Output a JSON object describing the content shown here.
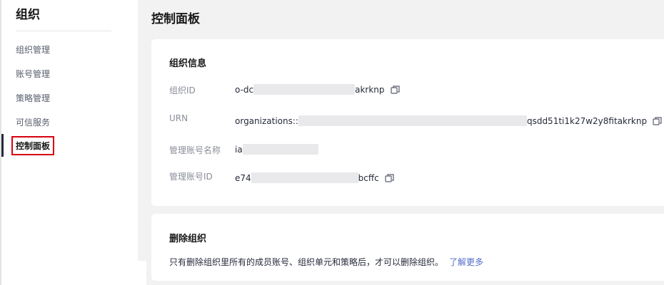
{
  "sidebar": {
    "title": "组织",
    "items": [
      {
        "label": "组织管理"
      },
      {
        "label": "账号管理"
      },
      {
        "label": "策略管理"
      },
      {
        "label": "可信服务"
      },
      {
        "label": "控制面板"
      }
    ]
  },
  "main": {
    "page_title": "控制面板",
    "org_info": {
      "title": "组织信息",
      "rows": [
        {
          "label": "组织ID",
          "prefix": "o-dc",
          "suffix": "akrknp"
        },
        {
          "label": "URN",
          "prefix": "organizations::",
          "suffix": "qsdd51ti1k27w2y8fitakrknp"
        },
        {
          "label": "管理账号名称",
          "prefix": "ia",
          "suffix": ""
        },
        {
          "label": "管理账号ID",
          "prefix": "e74",
          "suffix": "bcffc"
        }
      ]
    },
    "delete_org": {
      "title": "删除组织",
      "description": "只有删除组织里所有的成员账号、组织单元和策略后，才可以删除组织。",
      "link": "了解更多"
    }
  },
  "colors": {
    "accent_link": "#526ecc",
    "active_border": "#d7000f",
    "background": "#f2f2f2"
  }
}
